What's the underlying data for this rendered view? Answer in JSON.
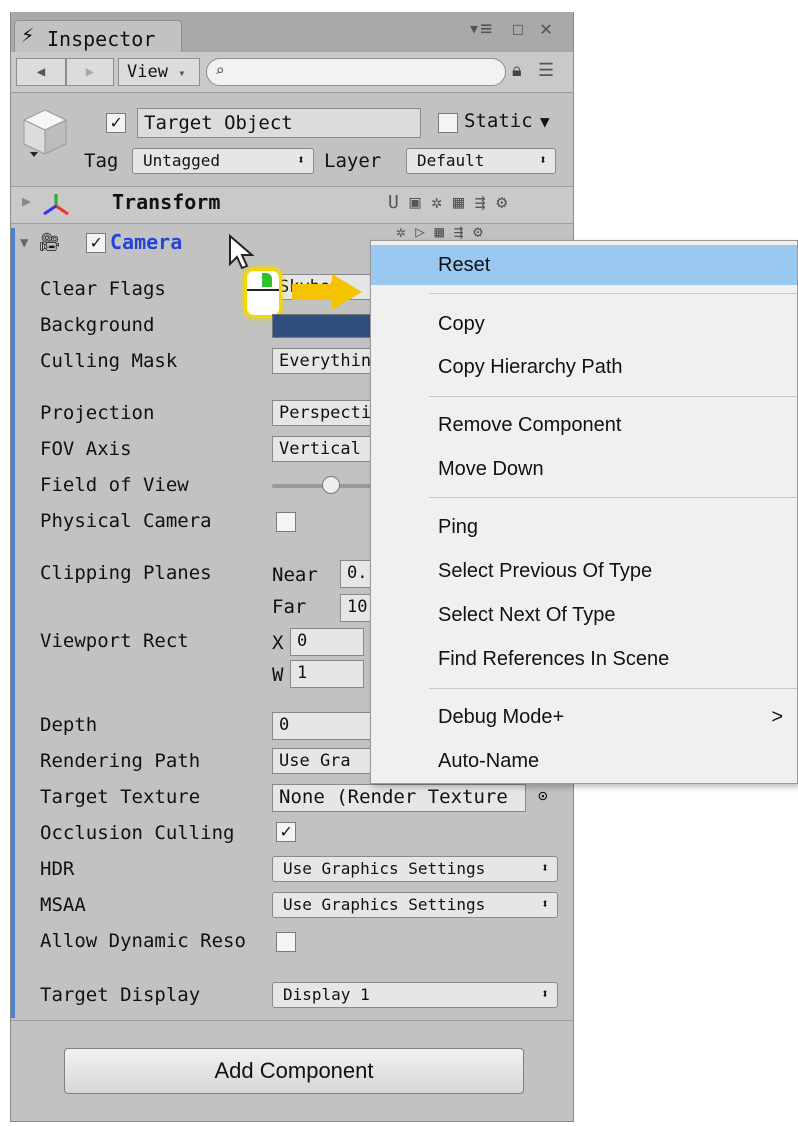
{
  "window": {
    "tab_title": "Inspector"
  },
  "toolbar": {
    "view_label": "View"
  },
  "header": {
    "object_name": "Target Object",
    "static_label": "Static",
    "tag_label": "Tag",
    "tag_value": "Untagged",
    "layer_label": "Layer",
    "layer_value": "Default"
  },
  "components": {
    "transform_label": "Transform",
    "camera_label": "Camera"
  },
  "camera": {
    "clear_flags_label": "Clear Flags",
    "clear_flags_value": "Skybox",
    "background_label": "Background",
    "background_color": "#2f4f7f",
    "culling_mask_label": "Culling Mask",
    "culling_mask_value": "Everything",
    "projection_label": "Projection",
    "projection_value": "Perspective",
    "fov_axis_label": "FOV Axis",
    "fov_axis_value": "Vertical",
    "field_of_view_label": "Field of View",
    "physical_camera_label": "Physical Camera",
    "clipping_planes_label": "Clipping Planes",
    "near_label": "Near",
    "near_value": "0.",
    "far_label": "Far",
    "far_value": "10",
    "viewport_rect_label": "Viewport Rect",
    "x_label": "X",
    "x_value": "0",
    "w_label": "W",
    "w_value": "1",
    "depth_label": "Depth",
    "depth_value": "0",
    "rendering_path_label": "Rendering Path",
    "rendering_path_value": "Use Gra",
    "target_texture_label": "Target Texture",
    "target_texture_value": "None (Render Texture",
    "occlusion_culling_label": "Occlusion Culling",
    "hdr_label": "HDR",
    "hdr_value": "Use Graphics Settings",
    "msaa_label": "MSAA",
    "msaa_value": "Use Graphics Settings",
    "allow_dynamic_label": "Allow Dynamic Reso",
    "target_display_label": "Target Display",
    "target_display_value": "Display 1"
  },
  "context_menu": {
    "items": [
      "Reset",
      "Copy",
      "Copy Hierarchy Path",
      "Remove Component",
      "Move Down",
      "Ping",
      "Select Previous Of Type",
      "Select Next Of Type",
      "Find References In Scene",
      "Debug Mode+",
      "Auto-Name"
    ],
    "submenu_arrow": ">"
  },
  "add_component_label": "Add Component",
  "colors": {
    "highlight": "#99c9f0",
    "accent": "#4a7fd6",
    "arrow": "#f5c400"
  }
}
